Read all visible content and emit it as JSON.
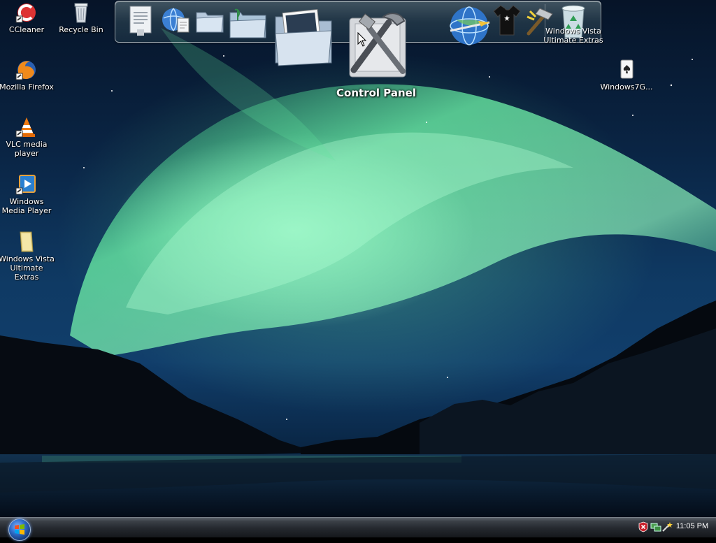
{
  "desktop": {
    "icons": [
      {
        "label": "CCleaner"
      },
      {
        "label": "Recycle Bin"
      },
      {
        "label": "Mozilla Firefox"
      },
      {
        "label": "VLC media player"
      },
      {
        "label": "Windows Media Player"
      },
      {
        "label": "Windows Vista Ultimate Extras"
      },
      {
        "label": "Windows7G..."
      }
    ]
  },
  "dock": {
    "hover_title": "Control Panel",
    "overlay_label": "Windows Vista Ultimate Extras",
    "items": [
      {
        "icon": "document-icon"
      },
      {
        "icon": "globe-document-icon"
      },
      {
        "icon": "folder-icon"
      },
      {
        "icon": "music-folder-icon"
      },
      {
        "icon": "pictures-folder-icon"
      },
      {
        "icon": "control-panel-tools-icon"
      },
      {
        "icon": "internet-globe-icon"
      },
      {
        "icon": "tshirt-icon"
      },
      {
        "icon": "hammer-icon"
      },
      {
        "icon": "recycle-bin-icon"
      }
    ]
  },
  "taskbar": {
    "clock": "11:05 PM",
    "tray_icons": [
      "security-alert-icon",
      "network-icon",
      "wand-icon"
    ]
  },
  "colors": {
    "aurora": "#7cf5a8",
    "sky": "#0f3a64",
    "taskbar": "#24282e"
  }
}
